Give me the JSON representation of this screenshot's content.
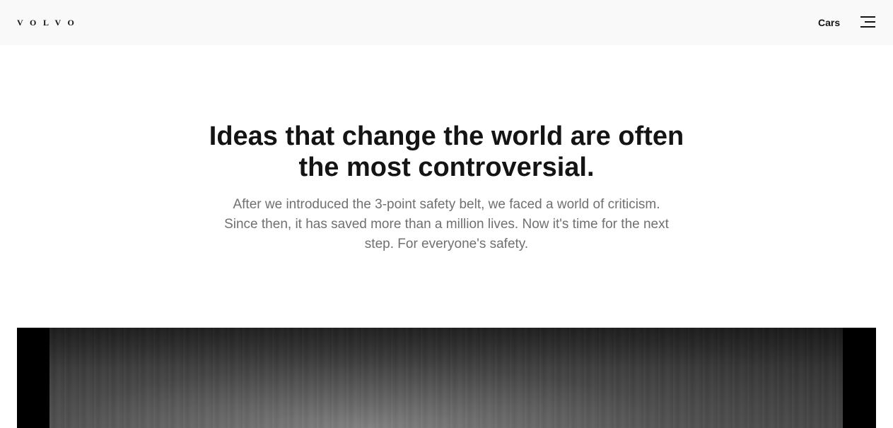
{
  "header": {
    "logo_text": "VOLVO",
    "nav_link": "Cars",
    "menu_icon": "hamburger-menu-icon"
  },
  "hero": {
    "title": "Ideas that change the world are often the most controversial.",
    "body": "After we introduced the 3-point safety belt, we faced a world of criticism. Since then, it has saved more than a million lives. Now it's time for the next step. For everyone's safety."
  },
  "colors": {
    "header_bg": "#f9f9f9",
    "text_primary": "#141414",
    "text_secondary": "#707070",
    "media_bg": "#000000"
  }
}
